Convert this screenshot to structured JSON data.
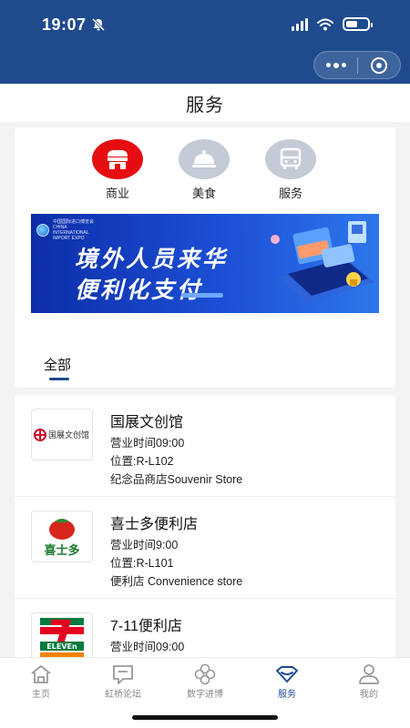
{
  "status_bar": {
    "time": "19:07"
  },
  "header": {
    "title": "服务"
  },
  "categories": [
    {
      "label": "商业",
      "icon": "shop-icon",
      "color": "#e60d12"
    },
    {
      "label": "美食",
      "icon": "food-cloche-icon",
      "color": "#c4cbd6"
    },
    {
      "label": "服务",
      "icon": "bus-icon",
      "color": "#c4cbd6"
    }
  ],
  "banner": {
    "logo_text_cn": "中国国际进口博览会",
    "logo_text_en": "CHINA INTERNATIONAL IMPORT EXPO",
    "line1": "境外人员来华",
    "line2": "便利化支付"
  },
  "filter": {
    "tab_all": "全部"
  },
  "stores": [
    {
      "name": "国展文创馆",
      "hours": "营业时间09:00",
      "location": "位置:R-L102",
      "type": "纪念品商店Souvenir Store",
      "logo_text": "国展文创馆"
    },
    {
      "name": "喜士多便利店",
      "hours": "营业时间9:00",
      "location": "位置:R-L101",
      "type": "便利店 Convenience store",
      "logo_text": "喜士多"
    },
    {
      "name": "7-11便利店",
      "hours": "营业时间09:00",
      "location": "",
      "type": "",
      "logo_text": "ELEVEn"
    }
  ],
  "tabbar": {
    "items": [
      {
        "label": "主页",
        "icon": "home-icon"
      },
      {
        "label": "虹桥论坛",
        "icon": "forum-icon"
      },
      {
        "label": "数字进博",
        "icon": "clover-icon"
      },
      {
        "label": "服务",
        "icon": "service-icon"
      },
      {
        "label": "我的",
        "icon": "profile-icon"
      }
    ],
    "active": "服务",
    "active_color": "#1f4b8e",
    "inactive_color": "#888888"
  },
  "theme": {
    "primary": "#1f4b8e",
    "accent_red": "#e60d12"
  }
}
